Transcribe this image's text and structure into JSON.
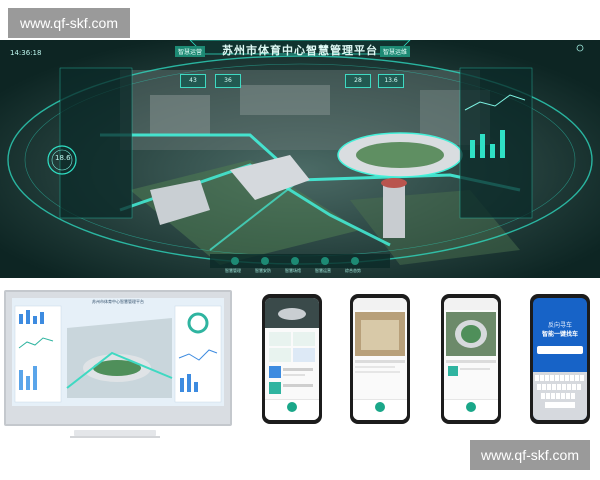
{
  "watermark": {
    "text": "www.qf-skf.com"
  },
  "dashboard": {
    "title": "苏州市体育中心智慧管理平台",
    "time": "14:36:18",
    "tag_left": "智慧运营",
    "tag_right": "智慧运维",
    "stats": [
      "43",
      "36",
      "28",
      "13.6"
    ],
    "gauge_value": "18.6",
    "nav": [
      "智慧管理",
      "智慧安防",
      "智慧场馆",
      "智慧运营",
      "综合态势"
    ],
    "colors": {
      "accent": "#2fe0c5",
      "bg": "#0a1e1d",
      "panel": "#145a50"
    }
  },
  "desktop": {
    "title": "苏州市体育中心智慧管理平台"
  },
  "phones": [
    {
      "name": "phone-1"
    },
    {
      "name": "phone-2"
    },
    {
      "name": "phone-3"
    },
    {
      "name": "phone-4",
      "title": "反向寻车",
      "subtitle": "智能一键找车"
    }
  ]
}
